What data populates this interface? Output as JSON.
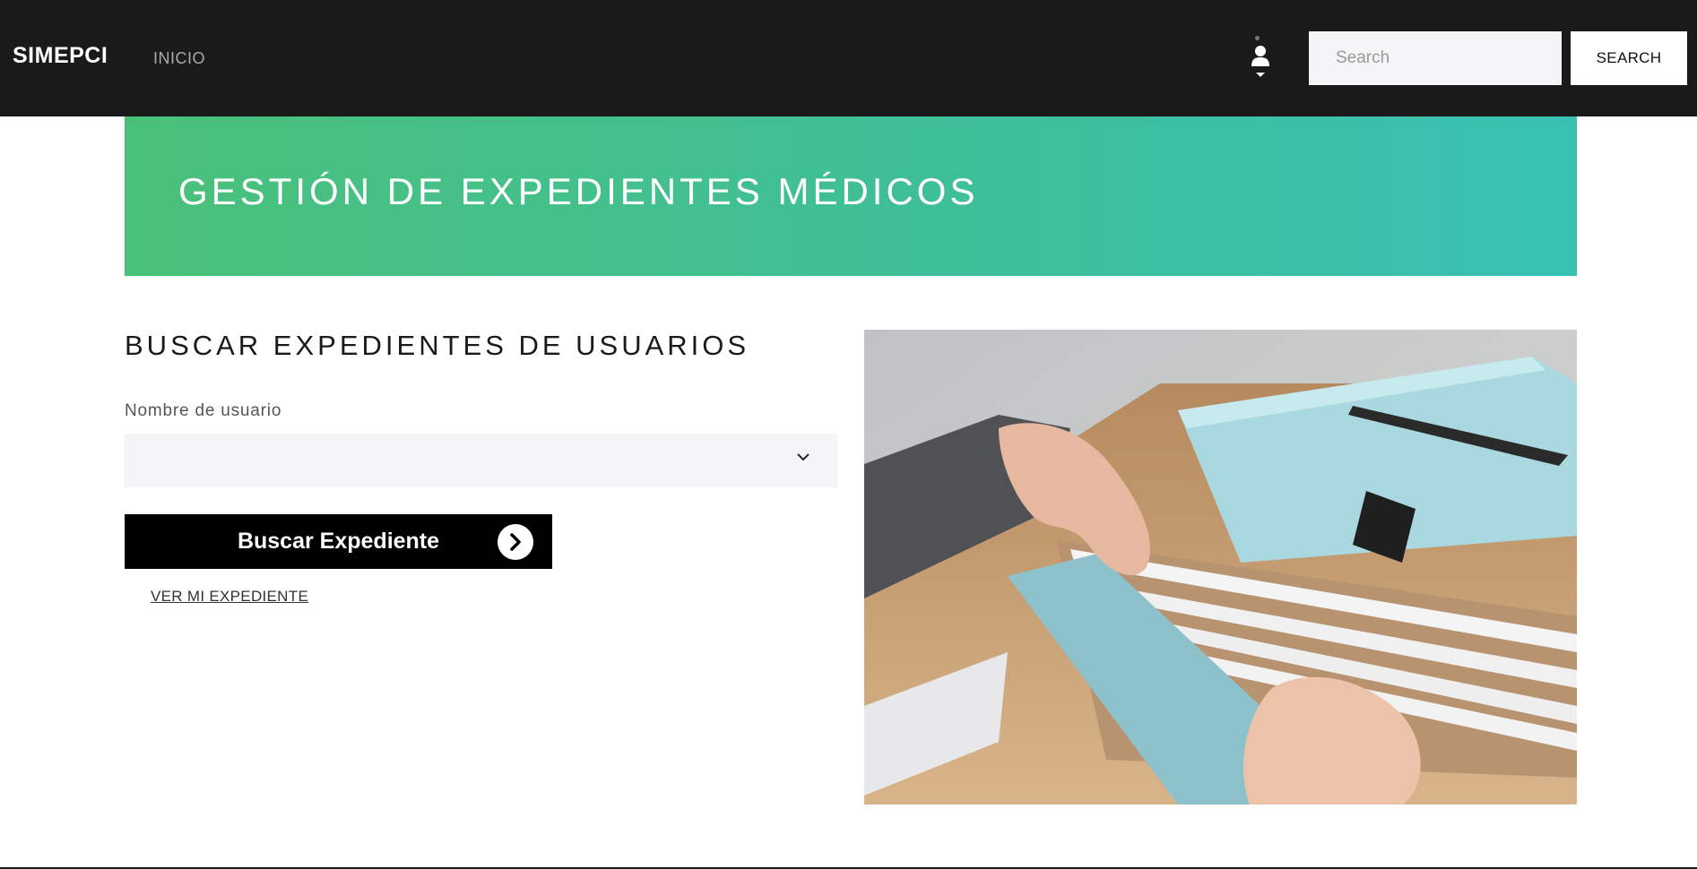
{
  "navbar": {
    "brand": "SIMEPCI",
    "links": [
      {
        "label": "INICIO"
      }
    ],
    "user_icon": "user-icon",
    "search": {
      "placeholder": "Search",
      "value": "",
      "button_label": "SEARCH"
    }
  },
  "hero": {
    "title": "GESTIÓN DE EXPEDIENTES MÉDICOS"
  },
  "main": {
    "section_title": "BUSCAR EXPEDIENTES DE USUARIOS",
    "username_field": {
      "label": "Nombre de usuario",
      "value": ""
    },
    "submit_button": {
      "label": "Buscar Expediente",
      "icon": "chevron-right-icon"
    },
    "my_record_link": "VER MI EXPEDIENTE"
  },
  "colors": {
    "navbar_bg": "#1a1a1a",
    "hero_gradient_start": "#4ac17a",
    "hero_gradient_end": "#38c0b2",
    "button_bg": "#000000",
    "input_bg": "#f5f5f7"
  }
}
